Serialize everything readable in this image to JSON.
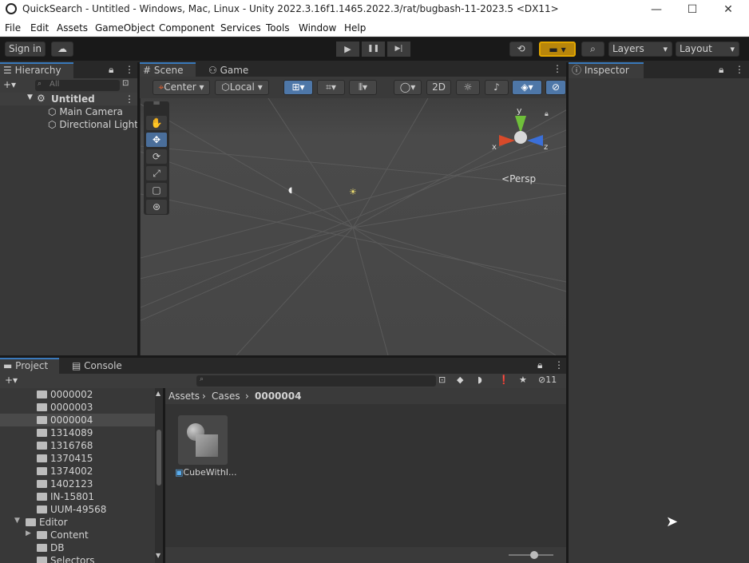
{
  "window": {
    "title": "QuickSearch - Untitled - Windows, Mac, Linux - Unity 2022.3.16f1.1465.2022.3/rat/bugbash-11-2023.5 <DX11>",
    "minimize": "—",
    "maximize": "☐",
    "close": "✕"
  },
  "menu": [
    "File",
    "Edit",
    "Assets",
    "GameObject",
    "Component",
    "Services",
    "Tools",
    "Window",
    "Help"
  ],
  "toolbar": {
    "sign_in": "Sign in",
    "cloud": "☁",
    "play": "▶",
    "pause": "❚❚",
    "step": "▶|",
    "history": "⟲",
    "collab": "▾",
    "search": "⌕",
    "layers": "Layers",
    "layout": "Layout"
  },
  "hierarchy": {
    "tab": "Hierarchy",
    "add": "+▾",
    "search_placeholder": "All",
    "scene": "Untitled",
    "items": [
      "Main Camera",
      "Directional Light"
    ]
  },
  "scene_view": {
    "tabs": [
      "Scene",
      "Game"
    ],
    "pivot": "Center",
    "space": "Local",
    "mode_2d": "2D",
    "axis_y": "y",
    "axis_x": "x",
    "axis_z": "z",
    "persp": "Persp",
    "tools": [
      "✋",
      "✥",
      "⟳",
      "⤢",
      "▢",
      "⊛"
    ]
  },
  "inspector": {
    "tab": "Inspector"
  },
  "project": {
    "tabs": [
      "Project",
      "Console"
    ],
    "add": "+▾",
    "hidden_count": "11",
    "tree": [
      {
        "label": "0000002",
        "indent": 1,
        "selected": false
      },
      {
        "label": "0000003",
        "indent": 1,
        "selected": false
      },
      {
        "label": "0000004",
        "indent": 1,
        "selected": true
      },
      {
        "label": "1314089",
        "indent": 1,
        "selected": false
      },
      {
        "label": "1316768",
        "indent": 1,
        "selected": false
      },
      {
        "label": "1370415",
        "indent": 1,
        "selected": false
      },
      {
        "label": "1374002",
        "indent": 1,
        "selected": false
      },
      {
        "label": "1402123",
        "indent": 1,
        "selected": false
      },
      {
        "label": "IN-15801",
        "indent": 1,
        "selected": false
      },
      {
        "label": "UUM-49568",
        "indent": 1,
        "selected": false
      },
      {
        "label": "Editor",
        "indent": 0,
        "selected": false
      },
      {
        "label": "Content",
        "indent": 1,
        "selected": false
      },
      {
        "label": "DB",
        "indent": 1,
        "selected": false
      },
      {
        "label": "Selectors",
        "indent": 1,
        "selected": false
      }
    ],
    "breadcrumb": [
      "Assets",
      "Cases",
      "0000004"
    ],
    "asset_label": "CubeWithI..."
  }
}
